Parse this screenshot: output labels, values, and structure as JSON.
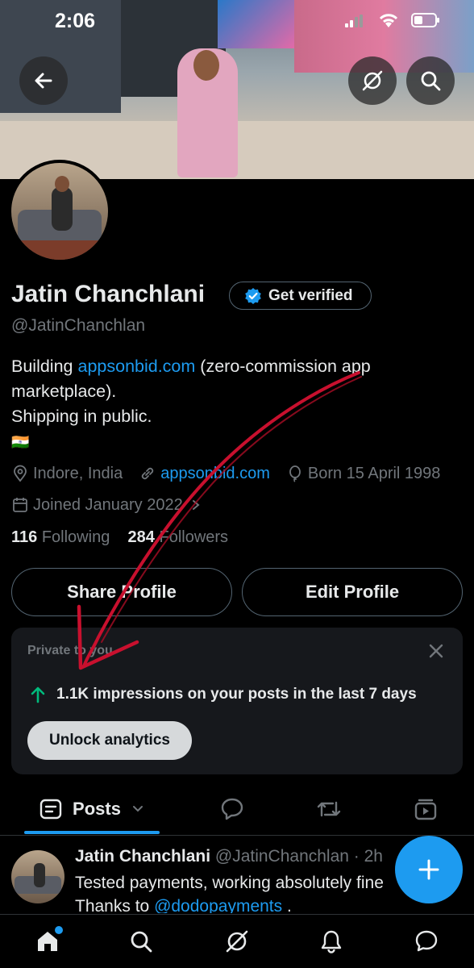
{
  "status_bar": {
    "time": "2:06"
  },
  "profile": {
    "name": "Jatin Chanchlani",
    "get_verified_label": "Get verified",
    "handle": "@JatinChanchlan",
    "bio_prefix": "Building ",
    "bio_link": "appsonbid.com",
    "bio_suffix": " (zero-commission app marketplace).",
    "bio_line2": "Shipping in public.",
    "bio_flag": "🇮🇳",
    "location": "Indore, India",
    "website": "appsonbid.com",
    "birthday": "Born 15 April 1998",
    "joined": "Joined January 2022",
    "following_count": "116",
    "following_label": "Following",
    "followers_count": "284",
    "followers_label": "Followers",
    "share_profile_label": "Share Profile",
    "edit_profile_label": "Edit Profile"
  },
  "analytics_card": {
    "private_label": "Private to you",
    "stat_text": "1.1K impressions on your posts in the last 7 days",
    "unlock_label": "Unlock analytics"
  },
  "tabs": {
    "posts_label": "Posts"
  },
  "post": {
    "author": "Jatin Chanchlani",
    "handle_time": "@JatinChanchlan · 2h",
    "line1": "Tested payments, working absolutely fine",
    "line2_prefix": "Thanks to ",
    "mention": "@dodopayments",
    "line2_suffix": " ."
  },
  "colors": {
    "accent": "#1d9bf0",
    "background": "#000000",
    "muted": "#71767b",
    "annotation_red": "#c8102e"
  },
  "icons": {
    "back": "arrow-left-icon",
    "grok": "grok-icon",
    "search": "search-icon",
    "verified": "verified-badge-icon",
    "location": "location-pin-icon",
    "link": "link-icon",
    "birthday": "balloon-icon",
    "calendar": "calendar-icon",
    "close": "close-icon",
    "trend": "arrow-up-icon",
    "replies": "speech-bubble-icon",
    "reposts": "repost-icon",
    "media": "video-icon",
    "compose": "plus-icon",
    "home": "home-icon",
    "messages": "envelope-icon",
    "notifications": "bell-icon"
  }
}
